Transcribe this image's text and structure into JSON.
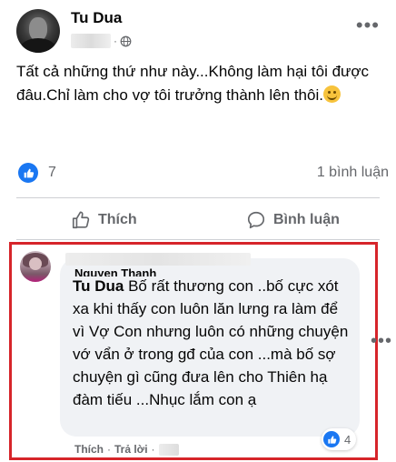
{
  "post": {
    "author": "Tu Dua",
    "text": "Tất cả những thứ như này...Không làm hại tôi được đâu.Chỉ làm cho vợ tôi trưởng thành lên thôi.",
    "meta_dot": "·",
    "emoji": "smile-icon"
  },
  "stats": {
    "like_count": "7",
    "comment_count": "1 bình luận"
  },
  "actions": {
    "like_label": "Thích",
    "comment_label": "Bình luận"
  },
  "comment": {
    "author": "Nguyen Thanh",
    "tagged_name": "Tu Dua",
    "text": " Bố rất thương con ..bố cực xót xa khi thấy con luôn lăn lưng ra làm để vì Vợ Con nhưng luôn có những chuyện vớ vẩn ở trong gđ của con ...mà bố sợ chuyện gì cũng đưa lên cho Thiên hạ đàm tiếu ...Nhục lắm con ạ",
    "reaction_count": "4",
    "like_action": "Thích",
    "reply_action": "Trả lời",
    "separator": "·"
  },
  "colors": {
    "accent": "#1a77f2",
    "highlight_border": "#d6252a",
    "bubble_bg": "#f0f2f5",
    "muted_text": "#65676b"
  }
}
